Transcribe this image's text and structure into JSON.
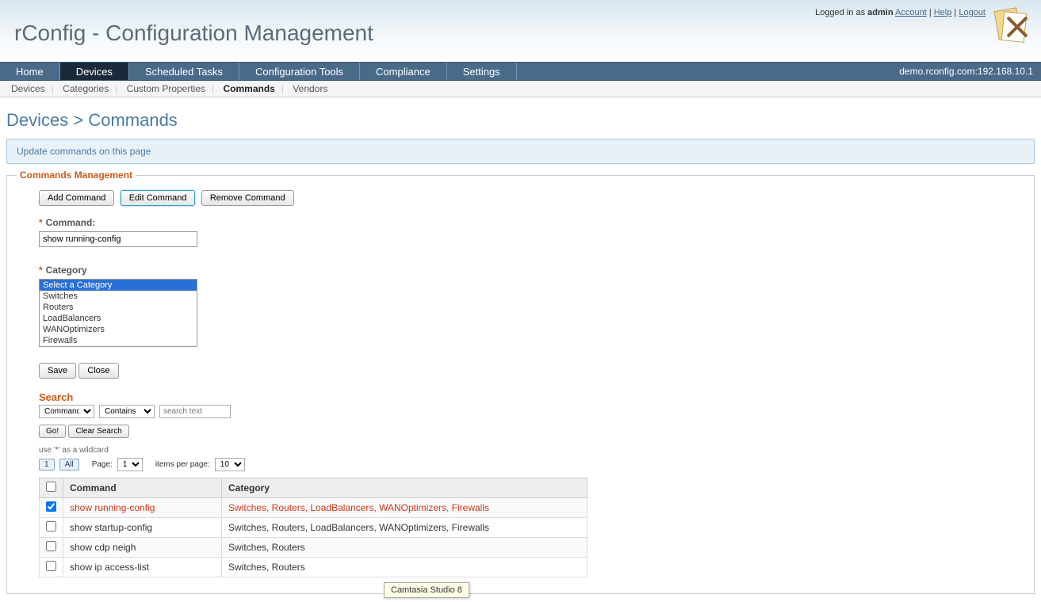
{
  "header": {
    "logged_in_prefix": "Logged in as ",
    "username": "admin",
    "account_link": "Account",
    "help_link": "Help",
    "logout_link": "Logout",
    "app_title": "rConfig - Configuration Management"
  },
  "main_nav": {
    "items": [
      "Home",
      "Devices",
      "Scheduled Tasks",
      "Configuration Tools",
      "Compliance",
      "Settings"
    ],
    "active_index": 1,
    "server_label": "demo.rconfig.com:192.168.10.1"
  },
  "sub_nav": {
    "items": [
      "Devices",
      "Categories",
      "Custom Properties",
      "Commands",
      "Vendors"
    ],
    "active_index": 3
  },
  "breadcrumb": "Devices > Commands",
  "banner": "Update commands on this page",
  "fieldset": {
    "legend": "Commands Management",
    "buttons": {
      "add": "Add Command",
      "edit": "Edit Command",
      "remove": "Remove Command"
    },
    "command_label": "Command:",
    "command_value": "show running-config",
    "category_label": "Category",
    "category_options": [
      "Select a Category",
      "Switches",
      "Routers",
      "LoadBalancers",
      "WANOptimizers",
      "Firewalls"
    ],
    "save": "Save",
    "close": "Close"
  },
  "search": {
    "title": "Search",
    "field_select": "Command",
    "op_select": "Contains",
    "placeholder": "search text",
    "go": "Go!",
    "clear": "Clear Search",
    "hint": "use '*' as a wildcard",
    "page_btn_1": "1",
    "page_btn_all": "All",
    "page_label": "Page:",
    "page_value": "1",
    "items_label": "items per page:",
    "items_value": "10"
  },
  "table": {
    "col_command": "Command",
    "col_category": "Category",
    "rows": [
      {
        "checked": true,
        "highlight": true,
        "command": "show running-config",
        "category": "Switches, Routers, LoadBalancers, WANOptimizers, Firewalls"
      },
      {
        "checked": false,
        "highlight": false,
        "command": "show startup-config",
        "category": "Switches, Routers, LoadBalancers, WANOptimizers, Firewalls"
      },
      {
        "checked": false,
        "highlight": false,
        "command": "show cdp neigh",
        "category": "Switches, Routers"
      },
      {
        "checked": false,
        "highlight": false,
        "command": "show ip access-list",
        "category": "Switches, Routers"
      }
    ]
  },
  "tooltip": "Camtasia Studio 8"
}
